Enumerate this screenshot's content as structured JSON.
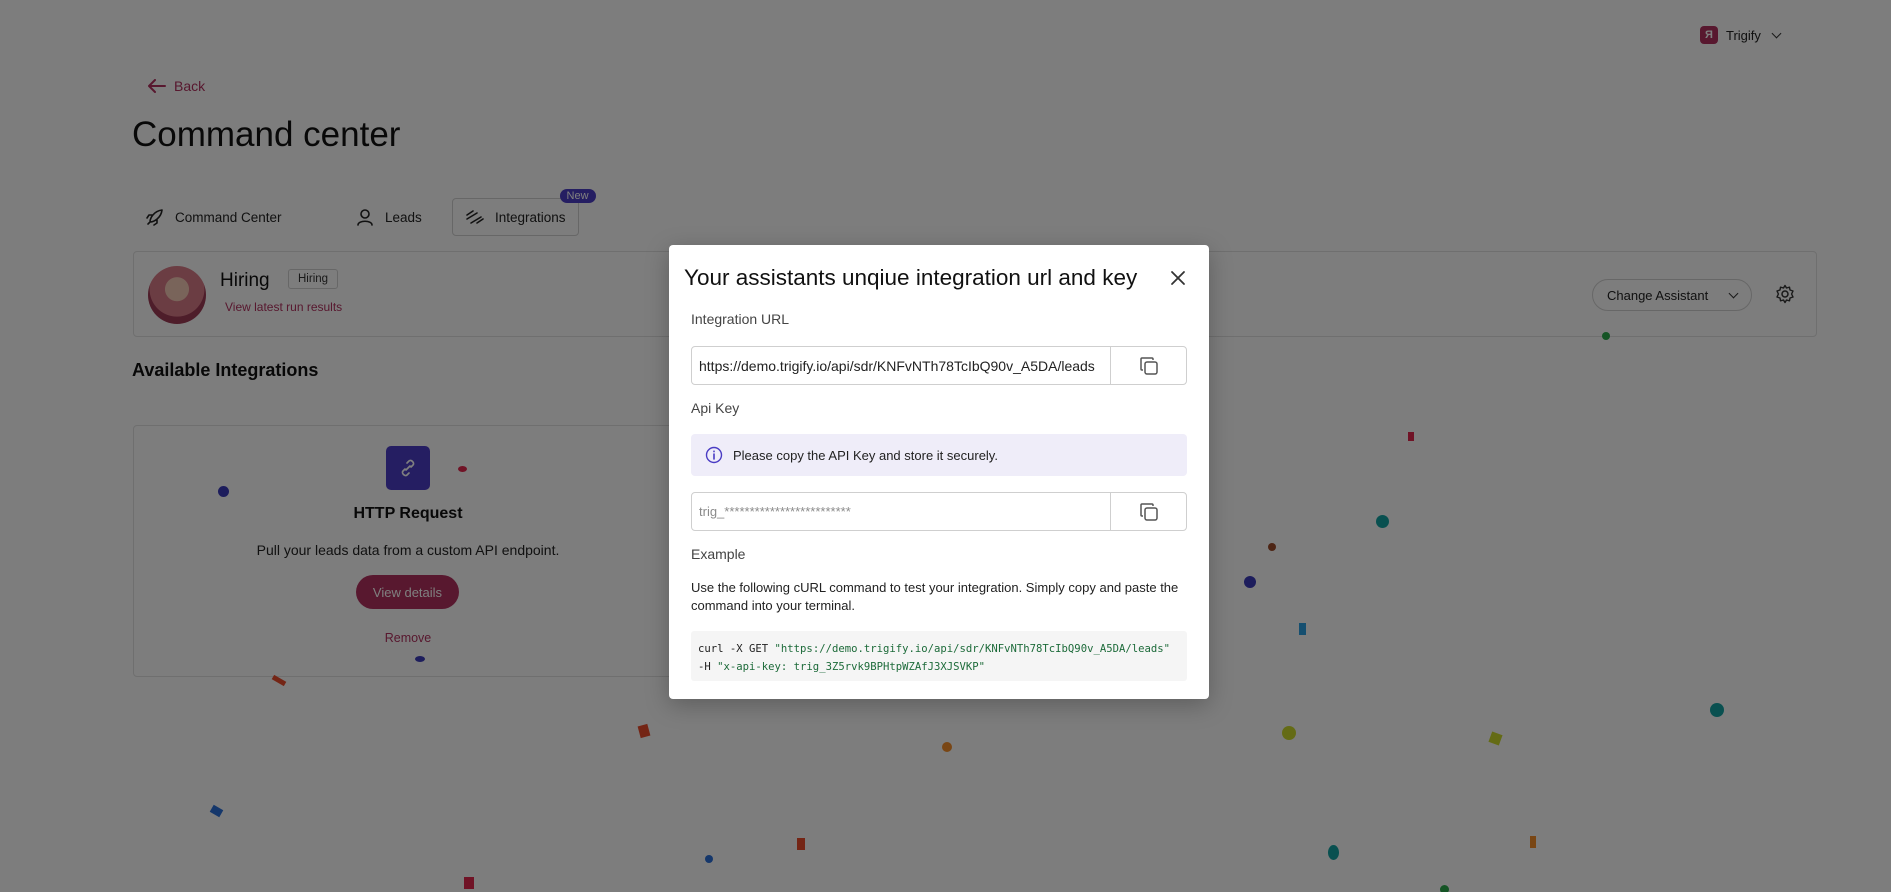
{
  "account": {
    "name": "Trigify",
    "logo_letter": "Я"
  },
  "header": {
    "back_label": "Back",
    "title": "Command center"
  },
  "tabs": [
    {
      "label": "Command Center",
      "icon": "rocket-icon"
    },
    {
      "label": "Leads",
      "icon": "user-icon"
    },
    {
      "label": "Integrations",
      "icon": "integrations-icon",
      "badge": "New",
      "active": true
    }
  ],
  "assistant": {
    "name": "Hiring",
    "badge": "Hiring",
    "run_link": "View latest run results",
    "change_label": "Change Assistant"
  },
  "integrations": {
    "section_title": "Available Integrations",
    "cards": [
      {
        "title": "HTTP Request",
        "description": "Pull your leads data from a custom API endpoint.",
        "details_label": "View details",
        "remove_label": "Remove"
      }
    ]
  },
  "modal": {
    "title": "Your assistants unqiue integration url and key",
    "url_label": "Integration URL",
    "url_value": "https://demo.trigify.io/api/sdr/KNFvNTh78TcIbQ90v_A5DA/leads",
    "key_label": "Api Key",
    "key_notice": "Please copy the API Key and store it securely.",
    "key_value": "trig_*************************",
    "example_label": "Example",
    "example_desc": "Use the following cURL command to test your integration. Simply copy and paste the command into your terminal.",
    "code_line1_cmd": "curl -X GET ",
    "code_line1_str": "\"https://demo.trigify.io/api/sdr/KNFvNTh78TcIbQ90v_A5DA/leads\"",
    "code_line2_cmd": "-H ",
    "code_line2_str": "\"x-api-key: trig_3Z5rvk9BPHtpWZAfJ3XJSVKP\""
  },
  "colors": {
    "brand": "#b0305e",
    "accent_purple": "#4a3cc4",
    "notice_bg": "#efedf9"
  }
}
